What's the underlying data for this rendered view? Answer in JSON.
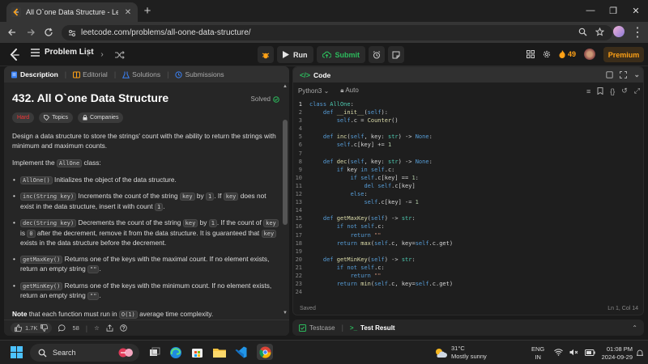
{
  "browser": {
    "tab_title": "All O`one Data Structure - Leetc",
    "url": "leetcode.com/problems/all-oone-data-structure/"
  },
  "header": {
    "problem_list_label": "Problem List",
    "run_label": "Run",
    "submit_label": "Submit",
    "streak_count": "49",
    "premium_label": "Premium"
  },
  "left_tabs": [
    {
      "label": "Description"
    },
    {
      "label": "Editorial"
    },
    {
      "label": "Solutions"
    },
    {
      "label": "Submissions"
    }
  ],
  "problem": {
    "title": "432. All O`one Data Structure",
    "solved_label": "Solved",
    "tags": [
      "Hard",
      "Topics",
      "Companies"
    ],
    "intro": "Design a data structure to store the strings' count with the ability to return the strings with minimum and maximum counts.",
    "implement_prefix": "Implement the ",
    "implement_class": "AllOne",
    "implement_suffix": " class:",
    "methods": [
      {
        "sig": "AllOne()",
        "text": " Initializes the object of the data structure."
      },
      {
        "sig": "inc(String key)",
        "t1": " Increments the count of the string ",
        "c1": "key",
        "t2": " by ",
        "c2": "1",
        "t3": ". If ",
        "c3": "key",
        "t4": " does not exist in the data structure, insert it with count ",
        "c4": "1",
        "t5": "."
      },
      {
        "sig": "dec(String key)",
        "t1": " Decrements the count of the string ",
        "c1": "key",
        "t2": " by ",
        "c2": "1",
        "t3": ". If the count of ",
        "c3": "key",
        "t4": " is ",
        "c4": "0",
        "t5": " after the decrement, remove it from the data structure. It is guaranteed that ",
        "c5": "key",
        "t6": " exists in the data structure before the decrement."
      },
      {
        "sig": "getMaxKey()",
        "text": " Returns one of the keys with the maximal count. If no element exists, return an empty string ",
        "code": "\"\"",
        "end": "."
      },
      {
        "sig": "getMinKey()",
        "text": " Returns one of the keys with the minimum count. If no element exists, return an empty string ",
        "code": "\"\"",
        "end": "."
      }
    ],
    "note_bold": "Note",
    "note_text": " that each function must run in ",
    "note_code": "O(1)",
    "note_end": " average time complexity.",
    "likes": "1.7K",
    "comments": "58"
  },
  "code": {
    "panel_title": "Code",
    "language": "Python3",
    "autosave": "Auto",
    "status_left": "Saved",
    "status_right": "Ln 1, Col 14"
  },
  "test": {
    "testcase_label": "Testcase",
    "result_label": "Test Result"
  },
  "taskbar": {
    "search_placeholder": "Search",
    "temperature": "31°C",
    "weather": "Mostly sunny",
    "lang1": "ENG",
    "lang2": "IN",
    "time": "01:08 PM",
    "date": "2024-09-29"
  }
}
